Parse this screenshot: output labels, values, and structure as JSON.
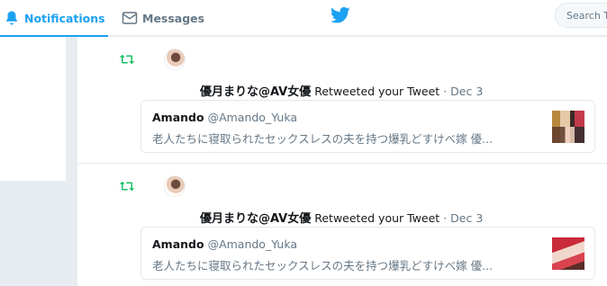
{
  "nav": {
    "notifications_label": "Notifications",
    "messages_label": "Messages",
    "search_placeholder": "Search T"
  },
  "colors": {
    "accent": "#1da1f2",
    "retweet_green": "#17bf63",
    "muted": "#657786",
    "background": "#e6ecf0"
  },
  "icons": [
    "bell-icon",
    "envelope-icon",
    "twitter-bird-icon",
    "retweet-icon"
  ],
  "notifications": [
    {
      "actor_name": "優月まりな@AV女優",
      "action": "Retweeted your Tweet",
      "separator": "·",
      "date": "Dec 3",
      "quoted": {
        "author": "Amando",
        "handle": "@Amando_Yuka",
        "text": "老人たちに寝取られたセックスレスの夫を持つ爆乳どすけべ嫁 優..."
      }
    },
    {
      "actor_name": "優月まりな@AV女優",
      "action": "Retweeted your Tweet",
      "separator": "·",
      "date": "Dec 3",
      "quoted": {
        "author": "Amando",
        "handle": "@Amando_Yuka",
        "text": "老人たちに寝取られたセックスレスの夫を持つ爆乳どすけべ嫁 優..."
      }
    }
  ]
}
